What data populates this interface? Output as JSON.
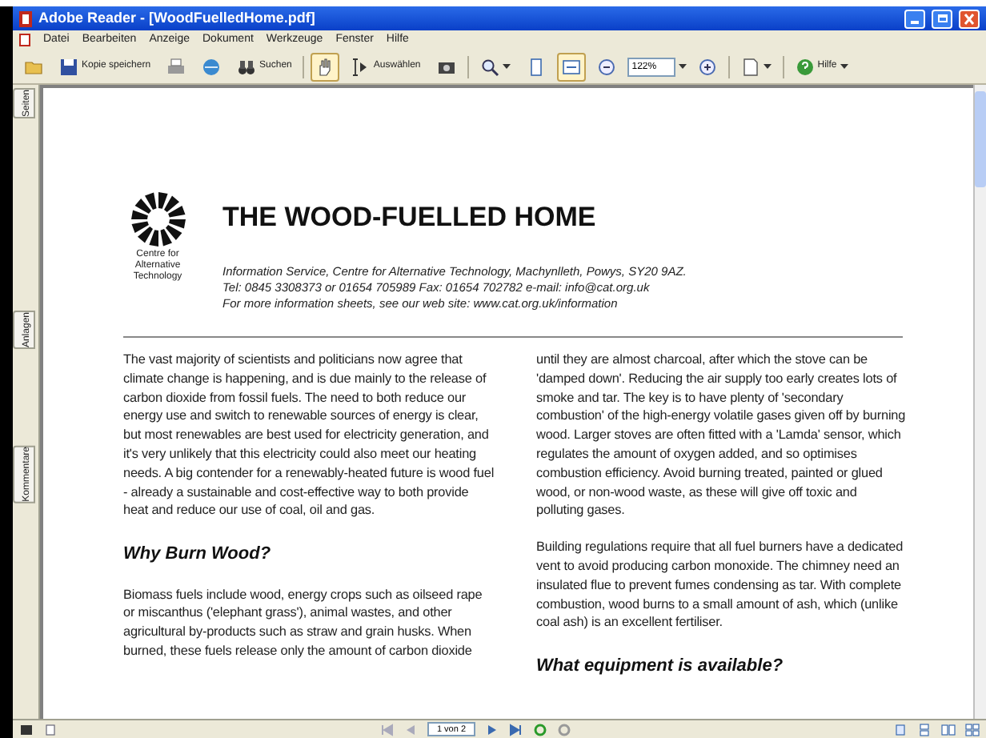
{
  "window": {
    "title": "Adobe Reader - [WoodFuelledHome.pdf]"
  },
  "menu": [
    "Datei",
    "Bearbeiten",
    "Anzeige",
    "Dokument",
    "Werkzeuge",
    "Fenster",
    "Hilfe"
  ],
  "toolbar": [
    {
      "kind": "icon"
    },
    {
      "kind": "labeled",
      "label": "Kopie speichern"
    },
    {
      "kind": "icon"
    },
    {
      "kind": "icon"
    },
    {
      "kind": "labeled",
      "label": "Suchen"
    },
    {
      "kind": "sep"
    },
    {
      "kind": "icon",
      "selected": true
    },
    {
      "kind": "labeled",
      "label": "Auswählen",
      "selected": false
    },
    {
      "kind": "icon"
    },
    {
      "kind": "sep"
    },
    {
      "kind": "dropdown"
    },
    {
      "kind": "icon",
      "selected": false
    },
    {
      "kind": "icon",
      "selected": true
    },
    {
      "kind": "icon"
    },
    {
      "kind": "field",
      "value": "122%"
    },
    {
      "kind": "icon"
    },
    {
      "kind": "sep"
    },
    {
      "kind": "dropdown"
    },
    {
      "kind": "sep"
    },
    {
      "kind": "dropdown",
      "label": "Hilfe"
    }
  ],
  "side_tabs": [
    {
      "label": "Seiten"
    },
    {
      "label": "Anlagen"
    },
    {
      "label": "Kommentare"
    }
  ],
  "document": {
    "logo_text": "Centre for Alternative Technology",
    "title": "THE WOOD-FUELLED HOME",
    "contact": [
      "Information Service, Centre for Alternative Technology, Machynlleth, Powys, SY20 9AZ.",
      "Tel: 0845 3308373 or 01654 705989  Fax: 01654 702782  e-mail: info@cat.org.uk",
      "For more information sheets, see our web site: www.cat.org.uk/information"
    ],
    "columns": [
      [
        {
          "kind": "para",
          "text": "The vast majority of scientists and politicians now agree that climate change is happening, and is due mainly to the release of carbon dioxide from fossil fuels. The need to both reduce our energy use and switch to renewable sources of energy is clear, but most renewables are best used for electricity generation, and it's very unlikely that this electricity could also meet our heating needs. A big contender for a renewably-heated future is wood fuel - already a sustainable and cost-effective way to both provide heat and reduce our use of coal, oil and gas."
        },
        {
          "kind": "heading",
          "text": "Why Burn Wood?"
        },
        {
          "kind": "para",
          "text": "Biomass fuels include wood, energy crops such as oilseed rape or miscanthus ('elephant grass'), animal wastes, and other agricultural by-products such as straw and grain husks. When burned, these fuels release only the amount of carbon dioxide"
        }
      ],
      [
        {
          "kind": "para",
          "text": "until they are almost charcoal, after which the stove can be 'damped down'. Reducing the air supply too early creates lots of smoke and tar. The key is to have plenty of 'secondary combustion' of the high-energy volatile gases given off by burning wood. Larger stoves are often fitted with a 'Lamda' sensor, which regulates the amount of oxygen added, and so optimises combustion efficiency. Avoid burning treated, painted or glued wood, or non-wood waste, as these will give off toxic and polluting gases."
        },
        {
          "kind": "para",
          "text": "Building regulations require that all fuel burners have a dedicated vent to avoid producing carbon monoxide. The chimney need an insulated flue to prevent fumes condensing as tar. With complete combustion, wood burns to a small amount of ash, which (unlike coal ash) is an excellent fertiliser."
        },
        {
          "kind": "heading",
          "text": "What equipment is available?"
        }
      ]
    ]
  },
  "status_bar": {
    "page_field": "1 von 2"
  }
}
